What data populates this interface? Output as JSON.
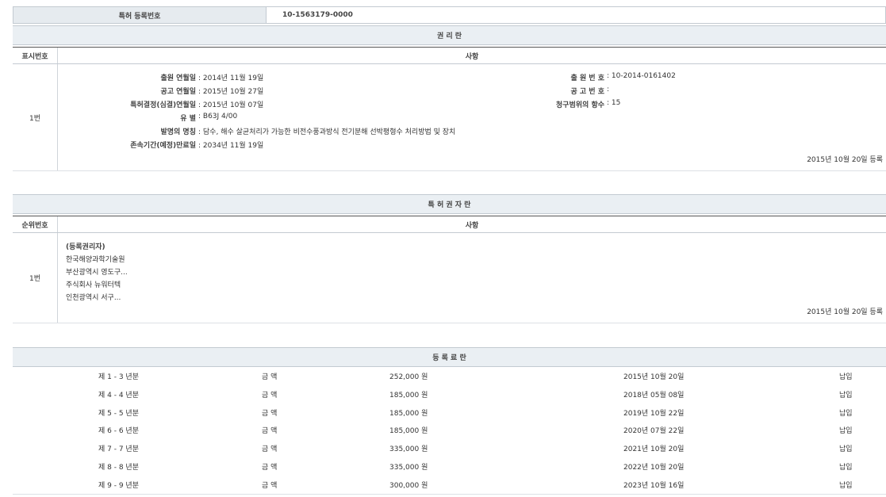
{
  "header": {
    "label": "특허 등록번호",
    "value": "10-1563179-0000"
  },
  "rights": {
    "title": "권 리 란",
    "col_num": "표시번호",
    "col_content": "사항",
    "row_num": "1번",
    "fields_left": [
      {
        "label": "출원 연월일",
        "value": "2014년 11월 19일"
      },
      {
        "label": "공고 연월일",
        "value": "2015년 10월 27일"
      },
      {
        "label": "특허결정(심결)연월일",
        "value": "2015년 10월 07일"
      },
      {
        "label": "유 별",
        "value": "B63J 4/00"
      },
      {
        "label": "발명의 명칭",
        "value": "담수, 해수 살균처리가 가능한 비전수풍과방식 전기분해 선박평형수 처리방법 및 장치"
      },
      {
        "label": "존속기간(예정)만료일",
        "value": "2034년 11월 19일"
      }
    ],
    "fields_right": [
      {
        "label": "출 원 번 호",
        "value": "10-2014-0161402"
      },
      {
        "label": "공 고 번 호",
        "value": ""
      },
      {
        "label": "청구범위의 항수",
        "value": "15"
      }
    ],
    "registered": "2015년 10월 20일 등록"
  },
  "holders": {
    "title": "특 허 권 자 란",
    "col_num": "순위번호",
    "col_content": "사항",
    "row_num": "1번",
    "lines": [
      "(등록권리자)",
      "한국해양과학기술원",
      "부산광역시 영도구...",
      "주식회사 뉴워터텍",
      "인천광역시 서구..."
    ],
    "registered": "2015년 10월 20일 등록"
  },
  "fees": {
    "title": "등 록 료 란",
    "rows": [
      {
        "period": "제 1 - 3 년분",
        "label": "금 액",
        "amount": "252,000 원",
        "date": "2015년 10월 20일",
        "status": "납입"
      },
      {
        "period": "제 4 - 4 년분",
        "label": "금 액",
        "amount": "185,000 원",
        "date": "2018년 05월 08일",
        "status": "납입"
      },
      {
        "period": "제 5 - 5 년분",
        "label": "금 액",
        "amount": "185,000 원",
        "date": "2019년 10월 22일",
        "status": "납입"
      },
      {
        "period": "제 6 - 6 년분",
        "label": "금 액",
        "amount": "185,000 원",
        "date": "2020년 07월 22일",
        "status": "납입"
      },
      {
        "period": "제 7 - 7 년분",
        "label": "금 액",
        "amount": "335,000 원",
        "date": "2021년 10월 20일",
        "status": "납입"
      },
      {
        "period": "제 8 - 8 년분",
        "label": "금 액",
        "amount": "335,000 원",
        "date": "2022년 10월 20일",
        "status": "납입"
      },
      {
        "period": "제 9 - 9 년분",
        "label": "금 액",
        "amount": "300,000 원",
        "date": "2023년 10월 16일",
        "status": "납입"
      }
    ]
  }
}
